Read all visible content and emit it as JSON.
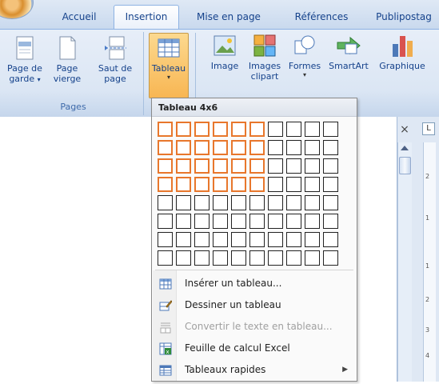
{
  "tabs": [
    {
      "label": "Accueil",
      "active": false
    },
    {
      "label": "Insertion",
      "active": true
    },
    {
      "label": "Mise en page",
      "active": false
    },
    {
      "label": "Références",
      "active": false
    },
    {
      "label": "Publipostag",
      "active": false
    }
  ],
  "ribbon": {
    "pages_group": {
      "label": "Pages",
      "buttons": [
        {
          "line1": "Page de",
          "line2": "garde",
          "has_dropdown": true,
          "icon": "cover-page-icon"
        },
        {
          "line1": "Page",
          "line2": "vierge",
          "has_dropdown": false,
          "icon": "blank-page-icon"
        },
        {
          "line1": "Saut de",
          "line2": "page",
          "has_dropdown": false,
          "icon": "page-break-icon"
        }
      ]
    },
    "table_button": {
      "label": "Tableau",
      "has_dropdown": true,
      "icon": "table-icon",
      "selected": true
    },
    "illustrations": [
      {
        "line1": "Image",
        "line2": "",
        "icon": "picture-icon",
        "has_dropdown": false
      },
      {
        "line1": "Images",
        "line2": "clipart",
        "icon": "clipart-icon",
        "has_dropdown": false
      },
      {
        "line1": "Formes",
        "line2": "",
        "icon": "shapes-icon",
        "has_dropdown": true
      },
      {
        "line1": "SmartArt",
        "line2": "",
        "icon": "smartart-icon",
        "has_dropdown": false
      },
      {
        "line1": "Graphique",
        "line2": "",
        "icon": "chart-icon",
        "has_dropdown": false
      }
    ]
  },
  "dropdown": {
    "title": "Tableau 4x6",
    "grid": {
      "columns": 10,
      "rows": 8,
      "highlight_columns": 6,
      "highlight_rows": 4
    },
    "items": [
      {
        "label": "Insérer un tableau...",
        "enabled": true,
        "icon": "insert-table-icon",
        "submenu": false
      },
      {
        "label": "Dessiner un tableau",
        "enabled": true,
        "icon": "draw-table-icon",
        "submenu": false
      },
      {
        "label": "Convertir le texte en tableau...",
        "enabled": false,
        "icon": "convert-text-icon",
        "submenu": false
      },
      {
        "label": "Feuille de calcul Excel",
        "enabled": true,
        "icon": "excel-sheet-icon",
        "submenu": false
      },
      {
        "label": "Tableaux rapides",
        "enabled": true,
        "icon": "quick-tables-icon",
        "submenu": true
      }
    ]
  },
  "side": {
    "close_symbol": "×",
    "ruler_toggle": "L",
    "ruler_marks": [
      "2",
      "1",
      "1",
      "2",
      "3",
      "4"
    ]
  },
  "colors": {
    "highlight": "#e8772c",
    "ribbon_text": "#15428b",
    "selected_button": "#f8b653"
  }
}
